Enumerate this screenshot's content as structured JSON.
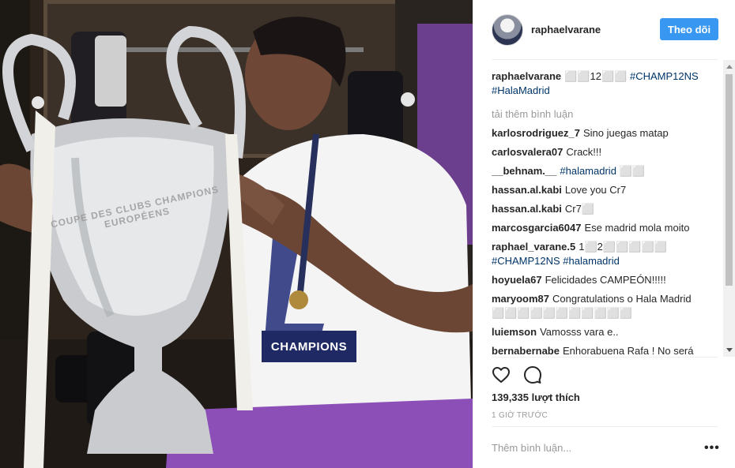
{
  "post": {
    "username": "raphaelvarane",
    "follow_label": "Theo dõi",
    "likes_text": "139,335 lượt thích",
    "time_text": "1 GIỜ TRƯỚC",
    "add_comment_placeholder": "Thêm bình luận...",
    "more_options": "•••"
  },
  "photo": {
    "shirt_print": "CHAMPIONS",
    "trophy_engraving": "COUPE DES CLUBS CHAMPIONS EUROPÉENS"
  },
  "caption": {
    "user": "raphaelvarane",
    "text": "⬜⬜12⬜⬜ ",
    "tags": [
      "#CHAMP12NS",
      "#HalaMadrid"
    ]
  },
  "load_more_label": "tải thêm bình luận",
  "comments": [
    {
      "user": "karlosrodriguez_7",
      "text": "Sino juegas matap",
      "tag": ""
    },
    {
      "user": "carlosvalera07",
      "text": "Crack!!!",
      "tag": ""
    },
    {
      "user": "__behnam.__",
      "text": "",
      "tag": "#halamadrid",
      "tail": " ⬜⬜"
    },
    {
      "user": "hassan.al.kabi",
      "text": "Love you Cr7",
      "tag": ""
    },
    {
      "user": "hassan.al.kabi",
      "text": "Cr7⬜",
      "tag": ""
    },
    {
      "user": "marcosgarcia6047",
      "text": "Ese madrid mola moito",
      "tag": ""
    },
    {
      "user": "raphael_varane.5",
      "text": "1⬜2⬜⬜⬜⬜⬜",
      "tag": "#CHAMP12NS #halamadrid"
    },
    {
      "user": "hoyuela67",
      "text": "Felicidades CAMPEÓN!!!!!",
      "tag": ""
    },
    {
      "user": "maryoom87",
      "text": "Congratulations o Hala Madrid ⬜⬜⬜⬜⬜⬜⬜⬜⬜⬜⬜",
      "tag": ""
    },
    {
      "user": "luiemson",
      "text": "Vamosss vara e..",
      "tag": ""
    },
    {
      "user": "bernabernabe",
      "text": "Enhorabuena Rafa ! No será",
      "tag": ""
    }
  ],
  "icons": {
    "like": "heart-icon",
    "comment": "comment-bubble-icon",
    "more": "more-options-icon"
  },
  "colors": {
    "follow_button": "#3897f0",
    "hashtag": "#003569",
    "muted": "#999999"
  }
}
